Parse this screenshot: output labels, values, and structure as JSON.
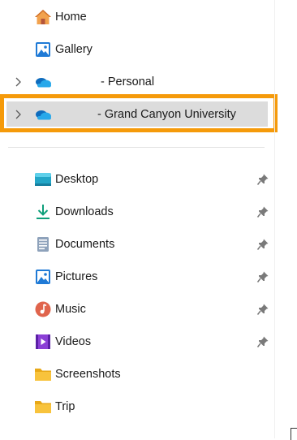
{
  "nav": {
    "home": {
      "label": "Home",
      "icon": "home-icon"
    },
    "gallery": {
      "label": "Gallery",
      "icon": "gallery-icon"
    },
    "onedrive_personal": {
      "label": "- Personal",
      "icon": "onedrive-cloud-icon"
    },
    "onedrive_gcu": {
      "label": "- Grand Canyon University",
      "icon": "onedrive-cloud-icon",
      "selected": true
    },
    "quick_access": [
      {
        "key": "desktop",
        "label": "Desktop",
        "icon": "desktop-folder-icon",
        "pinned": true
      },
      {
        "key": "downloads",
        "label": "Downloads",
        "icon": "download-arrow-icon",
        "pinned": true
      },
      {
        "key": "documents",
        "label": "Documents",
        "icon": "documents-icon",
        "pinned": true
      },
      {
        "key": "pictures",
        "label": "Pictures",
        "icon": "pictures-icon",
        "pinned": true
      },
      {
        "key": "music",
        "label": "Music",
        "icon": "music-icon",
        "pinned": true
      },
      {
        "key": "videos",
        "label": "Videos",
        "icon": "videos-icon",
        "pinned": true
      },
      {
        "key": "screenshots",
        "label": "Screenshots",
        "icon": "folder-icon",
        "pinned": false
      },
      {
        "key": "trip",
        "label": "Trip",
        "icon": "folder-icon",
        "pinned": false
      }
    ]
  },
  "colors": {
    "highlight_border": "#f59a0a",
    "selected_bg": "#dcdcdc",
    "onedrive_blue": "#0f6cbd",
    "folder_yellow": "#f8c33c"
  }
}
